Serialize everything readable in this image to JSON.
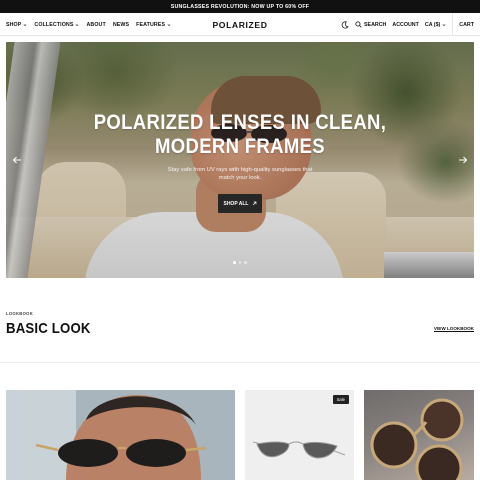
{
  "announcement": "Sunglasses revolution: now up to 60% off",
  "header": {
    "logo": "POLARIZED",
    "nav": [
      {
        "label": "Shop",
        "has_dropdown": true
      },
      {
        "label": "Collections",
        "has_dropdown": true
      },
      {
        "label": "About",
        "has_dropdown": false
      },
      {
        "label": "News",
        "has_dropdown": false
      },
      {
        "label": "Features",
        "has_dropdown": true
      }
    ],
    "theme_icon": "moon-icon",
    "search_label": "Search",
    "account_label": "Account",
    "currency_label": "CA ($)",
    "cart_label": "Cart"
  },
  "hero": {
    "title_line1": "Polarized lenses in clean,",
    "title_line2": "modern frames",
    "subtitle": "Stay safe from UV rays with high-quality sunglasses that match your look.",
    "button_label": "Shop all",
    "slides": 3,
    "active_slide": 1
  },
  "lookbook": {
    "eyebrow": "Lookbook",
    "title": "Basic look",
    "link_label": "View lookbook"
  },
  "cards": [
    {
      "name": "model-portrait",
      "badge": ""
    },
    {
      "name": "aviator-product",
      "badge": "Sale"
    },
    {
      "name": "sunglasses-closeup",
      "badge": ""
    }
  ],
  "colors": {
    "announcement_bg": "#111111",
    "button_bg": "#262626",
    "text": "#111111"
  }
}
